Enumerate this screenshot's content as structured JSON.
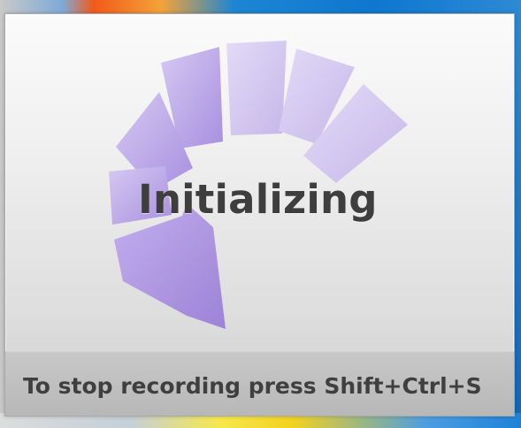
{
  "window": {
    "status": "Initializing",
    "hint": "To stop recording press Shift+Ctrl+S"
  },
  "colors": {
    "accent": "#b7a4e3",
    "text": "#3e3e3e",
    "bar": "#b9b9b9"
  },
  "icons": {
    "spinner": "circular-progress-arrow-icon"
  }
}
